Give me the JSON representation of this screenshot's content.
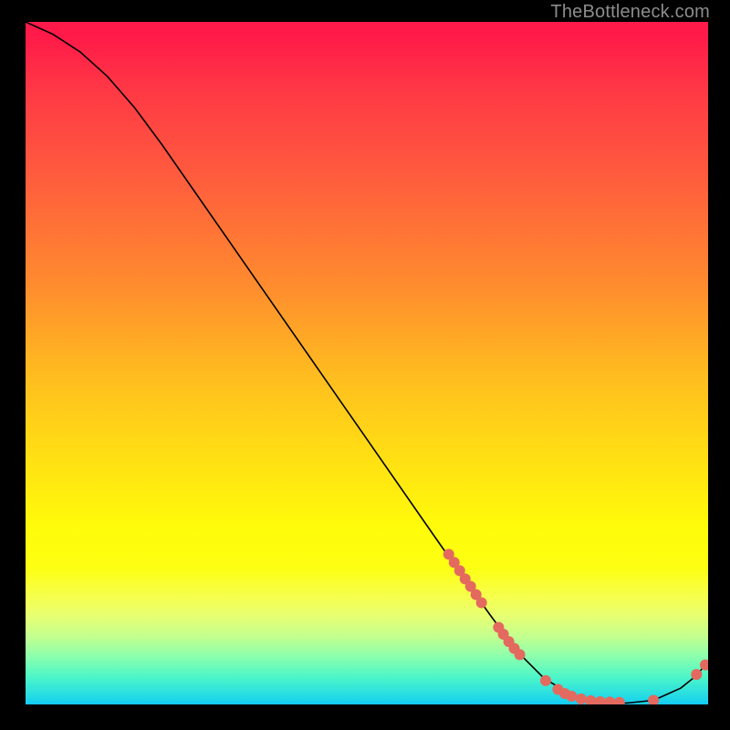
{
  "watermark": "TheBottleneck.com",
  "chart_data": {
    "type": "line",
    "title": "",
    "xlabel": "",
    "ylabel": "",
    "xlim": [
      0,
      100
    ],
    "ylim": [
      0,
      100
    ],
    "grid": false,
    "legend": false,
    "curve": [
      {
        "x": 0.0,
        "y": 100.0
      },
      {
        "x": 4.0,
        "y": 98.2
      },
      {
        "x": 8.0,
        "y": 95.6
      },
      {
        "x": 12.0,
        "y": 92.0
      },
      {
        "x": 16.0,
        "y": 87.4
      },
      {
        "x": 20.0,
        "y": 82.0
      },
      {
        "x": 28.0,
        "y": 70.5
      },
      {
        "x": 36.0,
        "y": 59.0
      },
      {
        "x": 44.0,
        "y": 47.5
      },
      {
        "x": 52.0,
        "y": 36.0
      },
      {
        "x": 60.0,
        "y": 24.5
      },
      {
        "x": 64.0,
        "y": 18.8
      },
      {
        "x": 68.0,
        "y": 13.2
      },
      {
        "x": 72.0,
        "y": 7.8
      },
      {
        "x": 76.0,
        "y": 3.8
      },
      {
        "x": 80.0,
        "y": 1.4
      },
      {
        "x": 84.0,
        "y": 0.4
      },
      {
        "x": 88.0,
        "y": 0.2
      },
      {
        "x": 92.0,
        "y": 0.6
      },
      {
        "x": 96.0,
        "y": 2.4
      },
      {
        "x": 98.0,
        "y": 4.0
      },
      {
        "x": 100.0,
        "y": 6.2
      }
    ],
    "markers": [
      {
        "x": 62.0,
        "y": 22.0
      },
      {
        "x": 62.8,
        "y": 20.8
      },
      {
        "x": 63.6,
        "y": 19.6
      },
      {
        "x": 64.4,
        "y": 18.4
      },
      {
        "x": 65.2,
        "y": 17.3
      },
      {
        "x": 66.0,
        "y": 16.1
      },
      {
        "x": 66.8,
        "y": 14.9
      },
      {
        "x": 69.3,
        "y": 11.3
      },
      {
        "x": 70.0,
        "y": 10.3
      },
      {
        "x": 70.8,
        "y": 9.2
      },
      {
        "x": 71.6,
        "y": 8.2
      },
      {
        "x": 72.4,
        "y": 7.3
      },
      {
        "x": 76.2,
        "y": 3.5
      },
      {
        "x": 78.0,
        "y": 2.2
      },
      {
        "x": 79.0,
        "y": 1.6
      },
      {
        "x": 80.0,
        "y": 1.2
      },
      {
        "x": 81.4,
        "y": 0.8
      },
      {
        "x": 82.8,
        "y": 0.55
      },
      {
        "x": 84.2,
        "y": 0.4
      },
      {
        "x": 85.6,
        "y": 0.35
      },
      {
        "x": 87.0,
        "y": 0.3
      },
      {
        "x": 92.0,
        "y": 0.6
      },
      {
        "x": 98.3,
        "y": 4.4
      },
      {
        "x": 99.6,
        "y": 5.8
      }
    ],
    "curve_color": "#000000",
    "marker_color": "#e4695f",
    "marker_radius_px": 6
  }
}
